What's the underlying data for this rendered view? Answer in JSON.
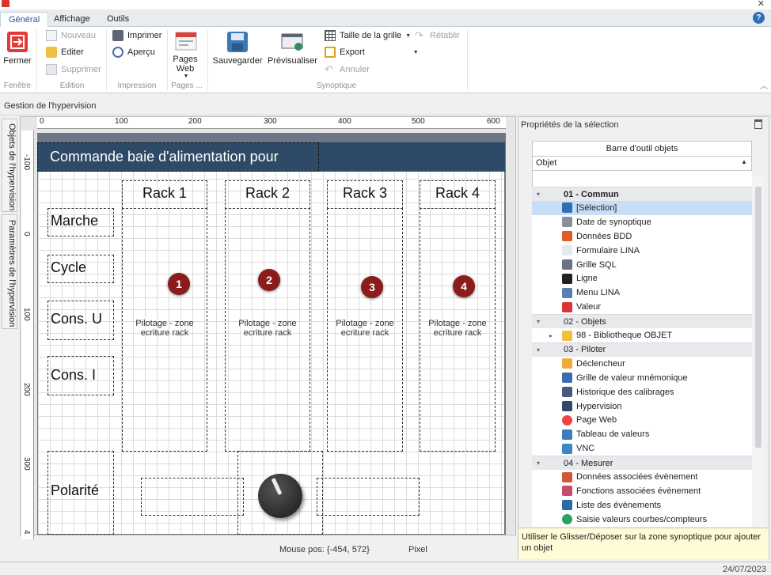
{
  "tabs": [
    "Général",
    "Affichage",
    "Outils"
  ],
  "ribbon": {
    "fermer": "Fermer",
    "nouveau": "Nouveau",
    "editer": "Editer",
    "supprimer": "Supprimer",
    "imprimer": "Imprimer",
    "apercu": "Aperçu",
    "pages_web": "Pages Web",
    "sauvegarder": "Sauvegarder",
    "previsualiser": "Prévisualiser",
    "taille_grille": "Taille de la grille",
    "export": "Export",
    "annuler": "Annuler",
    "retablir": "Rétablir",
    "groups": {
      "fenetre": "Fenêtre",
      "edition": "Edition",
      "impression": "Impression",
      "pages": "Pages ...",
      "synoptique": "Synoptique"
    }
  },
  "status_label": "Gestion de l'hypervision",
  "side_tabs": [
    "Objets de l'hypervision",
    "Paramètres de l'hypervision"
  ],
  "ruler": {
    "top": [
      "0",
      "100",
      "200",
      "300",
      "400",
      "500",
      "600"
    ],
    "left": [
      "-100",
      "0",
      "100",
      "200",
      "300",
      "4"
    ]
  },
  "canvas": {
    "title": "Commande baie d'alimentation pour",
    "left_labels": [
      "Marche",
      "Cycle",
      "Cons. U",
      "Cons. I",
      "Polarité"
    ],
    "racks": [
      {
        "name": "Rack 1",
        "badge": "1",
        "zone": "Pilotage - zone\necriture rack"
      },
      {
        "name": "Rack 2",
        "badge": "2",
        "zone": "Pilotage - zone\necriture rack"
      },
      {
        "name": "Rack 3",
        "badge": "3",
        "zone": "Pilotage - zone\necriture rack"
      },
      {
        "name": "Rack 4",
        "badge": "4",
        "zone": "Pilotage - zone\necriture rack"
      }
    ]
  },
  "canvas_status": {
    "mouse_pos": "Mouse pos: {-454, 572}",
    "unit": "Pixel"
  },
  "panel": {
    "title": "Propriétés de la sélection",
    "toolbar_header": "Barre d'outil objets",
    "column": "Objet",
    "hint": "Utiliser le Glisser/Déposer sur la zone synoptique pour ajouter un objet",
    "items": [
      {
        "type": "group",
        "label": "01 - Commun",
        "bold": true
      },
      {
        "type": "item",
        "label": "[Sélection]",
        "icon": "cursor-icon",
        "selected": true
      },
      {
        "type": "item",
        "label": "Date de synoptique",
        "icon": "calendar-icon"
      },
      {
        "type": "item",
        "label": "Données BDD",
        "icon": "database-icon"
      },
      {
        "type": "item",
        "label": "Formulaire LINA",
        "icon": "form-icon"
      },
      {
        "type": "item",
        "label": "Grille SQL",
        "icon": "grid-icon"
      },
      {
        "type": "item",
        "label": "Ligne",
        "icon": "line-icon"
      },
      {
        "type": "item",
        "label": "Menu LINA",
        "icon": "menu-icon"
      },
      {
        "type": "item",
        "label": "Valeur",
        "icon": "value-icon"
      },
      {
        "type": "group",
        "label": "02 - Objets"
      },
      {
        "type": "folder",
        "label": "98 - Bibliotheque OBJET",
        "icon": "folder-icon"
      },
      {
        "type": "group",
        "label": "03 - Piloter"
      },
      {
        "type": "item",
        "label": "Déclencheur",
        "icon": "lightning-icon"
      },
      {
        "type": "item",
        "label": "Grille de valeur mnémonique",
        "icon": "grid-value-icon"
      },
      {
        "type": "item",
        "label": "Historique des calibrages",
        "icon": "history-icon"
      },
      {
        "type": "item",
        "label": "Hypervision",
        "icon": "hypervision-icon"
      },
      {
        "type": "item",
        "label": "Page Web",
        "icon": "chrome-icon"
      },
      {
        "type": "item",
        "label": "Tableau de valeurs",
        "icon": "table-icon"
      },
      {
        "type": "item",
        "label": "VNC",
        "icon": "vnc-icon"
      },
      {
        "type": "group",
        "label": "04 - Mesurer"
      },
      {
        "type": "item",
        "label": "Données associées évènement",
        "icon": "event-data-icon"
      },
      {
        "type": "item",
        "label": "Fonctions associées évènement",
        "icon": "event-func-icon"
      },
      {
        "type": "item",
        "label": "Liste des évènements",
        "icon": "event-list-icon"
      },
      {
        "type": "item",
        "label": "Saisie valeurs courbes/compteurs",
        "icon": "add-icon"
      }
    ]
  },
  "footer_date": "24/07/2023"
}
